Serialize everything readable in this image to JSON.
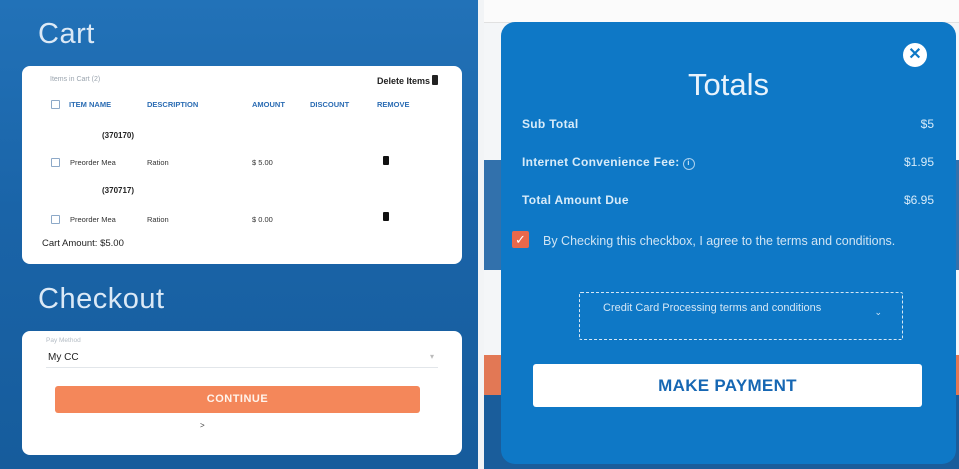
{
  "cart": {
    "title": "Cart",
    "items_in_cart_label": "Items in Cart (2)",
    "delete_items_label": "Delete Items",
    "columns": [
      "ITEM NAME",
      "DESCRIPTION",
      "AMOUNT",
      "DISCOUNT",
      "REMOVE"
    ],
    "items": [
      {
        "order_id": "(370170)",
        "name": "Preorder Mea",
        "description": "Ration",
        "amount": "$ 5.00"
      },
      {
        "order_id": "(370717)",
        "name": "Preorder Mea",
        "description": "Ration",
        "amount": "$ 0.00"
      }
    ],
    "cart_amount": "Cart Amount: $5.00"
  },
  "checkout": {
    "title": "Checkout",
    "payment_label": "Pay Method",
    "payment_value": "My CC",
    "continue_label": "CONTINUE",
    "small_caret": ">"
  },
  "modal": {
    "title": "Totals",
    "close_symbol": "✕",
    "rows": [
      {
        "label": "Sub Total",
        "value": "$5"
      },
      {
        "label": "Internet Convenience Fee:",
        "value": "$1.95"
      },
      {
        "label": "Total Amount Due",
        "value": "$6.95"
      }
    ],
    "agree_checked": true,
    "agree_text": "By Checking this checkbox, I agree to the terms and conditions.",
    "terms_select_label": "Credit Card Processing terms and conditions",
    "make_payment_label": "MAKE PAYMENT"
  },
  "icons": {
    "trash": "trash-icon",
    "info": "info-icon",
    "close": "close-icon",
    "chevron": "chevron-down-icon",
    "check": "check-icon"
  },
  "colors": {
    "left_background": "#1a64a8",
    "modal_background": "#0e78c6",
    "continue_button": "#f4875a",
    "checkbox": "#e8684a",
    "header_text": "#2b6cb3"
  }
}
